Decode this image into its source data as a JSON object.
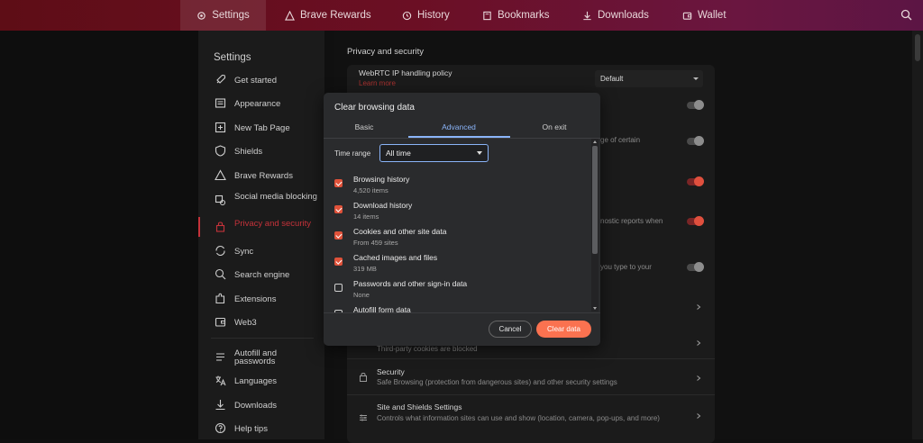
{
  "topbar": {
    "items": [
      {
        "label": "Settings",
        "icon": "gear-icon"
      },
      {
        "label": "Brave Rewards",
        "icon": "triangle-icon"
      },
      {
        "label": "History",
        "icon": "history-icon"
      },
      {
        "label": "Bookmarks",
        "icon": "bookmark-icon"
      },
      {
        "label": "Downloads",
        "icon": "download-icon"
      },
      {
        "label": "Wallet",
        "icon": "wallet-icon"
      }
    ]
  },
  "sidebar": {
    "title": "Settings",
    "items": [
      {
        "label": "Get started",
        "icon": "rocket-icon"
      },
      {
        "label": "Appearance",
        "icon": "appearance-icon"
      },
      {
        "label": "New Tab Page",
        "icon": "new-tab-icon"
      },
      {
        "label": "Shields",
        "icon": "shield-icon"
      },
      {
        "label": "Brave Rewards",
        "icon": "triangle-icon"
      },
      {
        "label": "Social media blocking",
        "icon": "social-icon"
      },
      {
        "label": "Privacy and security",
        "icon": "lock-icon"
      },
      {
        "label": "Sync",
        "icon": "sync-icon"
      },
      {
        "label": "Search engine",
        "icon": "search-icon"
      },
      {
        "label": "Extensions",
        "icon": "puzzle-icon"
      },
      {
        "label": "Web3",
        "icon": "wallet-icon"
      },
      {
        "label": "Autofill and passwords",
        "icon": "autofill-icon"
      },
      {
        "label": "Languages",
        "icon": "language-icon"
      },
      {
        "label": "Downloads",
        "icon": "download-icon"
      },
      {
        "label": "Help tips",
        "icon": "help-icon"
      }
    ]
  },
  "main": {
    "section_title": "Privacy and security",
    "webrtc_title": "WebRTC IP handling policy",
    "webrtc_link": "Learn more",
    "webrtc_value": "Default",
    "frag_certain": "ge of certain",
    "frag_reports": "nostic reports when",
    "frag_type": "you type to your",
    "cookies_sub": "Third-party cookies are blocked",
    "security_title": "Security",
    "security_sub": "Safe Browsing (protection from dangerous sites) and other security settings",
    "site_title": "Site and Shields Settings",
    "site_sub": "Controls what information sites can use and show (location, camera, pop-ups, and more)"
  },
  "dialog": {
    "title": "Clear browsing data",
    "tabs": [
      "Basic",
      "Advanced",
      "On exit"
    ],
    "time_range_label": "Time range",
    "time_range_value": "All time",
    "items": [
      {
        "title": "Browsing history",
        "sub": "4,520 items",
        "checked": true
      },
      {
        "title": "Download history",
        "sub": "14 items",
        "checked": true
      },
      {
        "title": "Cookies and other site data",
        "sub": "From 459 sites",
        "checked": true
      },
      {
        "title": "Cached images and files",
        "sub": "319 MB",
        "checked": true
      },
      {
        "title": "Passwords and other sign-in data",
        "sub": "None",
        "checked": false
      },
      {
        "title": "Autofill form data",
        "sub": "",
        "checked": false
      }
    ],
    "cancel_label": "Cancel",
    "clear_label": "Clear data"
  },
  "colors": {
    "accent": "#fa7250",
    "active_red": "#c5323a",
    "tab_blue": "#8ab4f8"
  }
}
